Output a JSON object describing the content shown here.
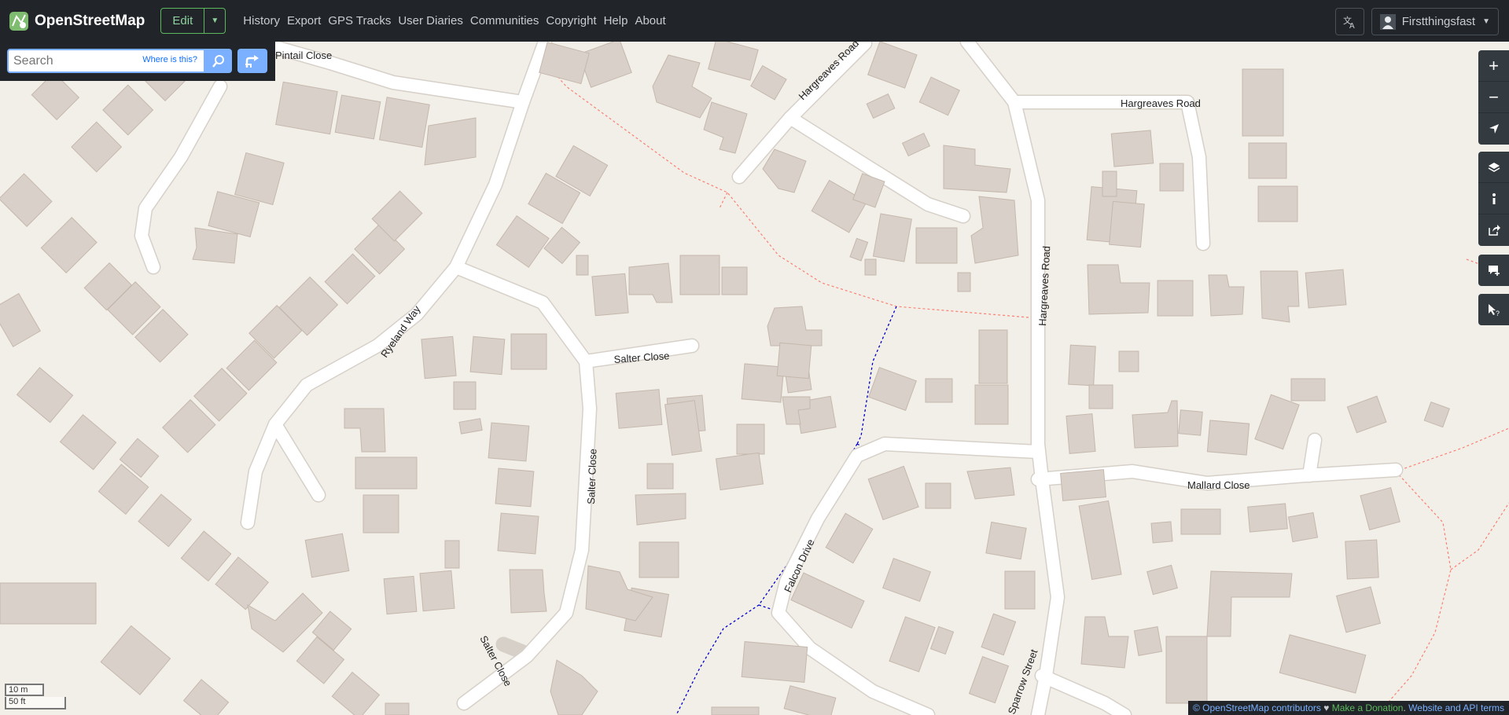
{
  "header": {
    "brand": "OpenStreetMap",
    "edit_label": "Edit",
    "nav": [
      "History",
      "Export",
      "GPS Tracks",
      "User Diaries",
      "Communities",
      "Copyright",
      "Help",
      "About"
    ],
    "username": "Firstthingsfast",
    "language_icon": "translate-icon",
    "user_icon": "user-icon"
  },
  "search": {
    "placeholder": "Search",
    "where_is_this": "Where is this?"
  },
  "map": {
    "road_labels": [
      "Hargreaves Road",
      "Hargreaves Road",
      "Hargreaves Road",
      "Ryeland Way",
      "Salter Close",
      "Salter Close",
      "Salter Close",
      "Mallard Close",
      "Falcon Drive",
      "Sparrow Street",
      "Pintail Close"
    ],
    "scale_metric": "10 m",
    "scale_imperial": "50 ft"
  },
  "controls": {
    "zoom": [
      "zoom-in-icon",
      "zoom-out-icon",
      "locate-icon"
    ],
    "tools": [
      "layers-icon",
      "info-icon",
      "share-icon"
    ],
    "notes": [
      "add-note-icon"
    ],
    "query": [
      "query-features-icon"
    ]
  },
  "attribution": {
    "copyright": "© OpenStreetMap contributors",
    "heart": "♥",
    "donate": "Make a Donation",
    "sep": ".",
    "terms": "Website and API terms"
  },
  "colors": {
    "header_bg": "#212529",
    "map_bg": "#f2efe9",
    "building": "#d9d0c9",
    "building_stroke": "#c5b8ad",
    "road": "#ffffff",
    "footpath": "#fa8072",
    "bridleway": "#0000cc",
    "accent": "#7ab0ff",
    "edit_green": "#5cb85c"
  }
}
